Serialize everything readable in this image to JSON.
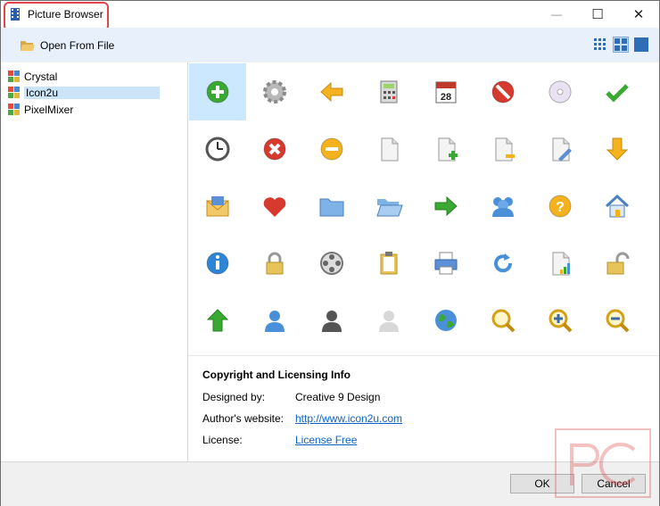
{
  "window": {
    "title": "Picture Browser",
    "accent": "#e0454a"
  },
  "controls": {
    "minimize": "—",
    "maximize": "☐",
    "close": "✕"
  },
  "toolbar": {
    "open_label": "Open From File",
    "view_modes": [
      "small-icons",
      "medium-icons",
      "large-icons"
    ],
    "active_view": "medium-icons"
  },
  "tree": {
    "items": [
      {
        "label": "Crystal"
      },
      {
        "label": "Icon2u"
      },
      {
        "label": "PixelMixer"
      }
    ],
    "selected": "Icon2u"
  },
  "icons": [
    "add-icon",
    "settings-icon",
    "back-arrow-icon",
    "calculator-icon",
    "calendar-icon",
    "stop-icon",
    "cd-icon",
    "check-icon",
    "clock-icon",
    "delete-icon",
    "minus-icon",
    "document-icon",
    "document-add-icon",
    "document-remove-icon",
    "document-edit-icon",
    "down-arrow-icon",
    "email-icon",
    "heart-icon",
    "folder-icon",
    "open-folder-icon",
    "forward-arrow-icon",
    "users-icon",
    "help-icon",
    "home-icon",
    "info-icon",
    "lock-icon",
    "film-reel-icon",
    "clipboard-icon",
    "printer-icon",
    "refresh-icon",
    "chart-document-icon",
    "unlock-icon",
    "up-arrow-icon",
    "user-blue-icon",
    "user-gray-icon",
    "user-white-icon",
    "globe-icon",
    "search-icon",
    "zoom-in-icon",
    "zoom-out-icon"
  ],
  "calendar_day": "28",
  "info": {
    "title": "Copyright and Licensing Info",
    "designed_by_label": "Designed by:",
    "designed_by_value": "Creative 9 Design",
    "website_label": "Author's website:",
    "website_value": "http://www.icon2u.com",
    "license_label": "License:",
    "license_value": "License Free"
  },
  "buttons": {
    "ok": "OK",
    "cancel": "Cancel"
  }
}
